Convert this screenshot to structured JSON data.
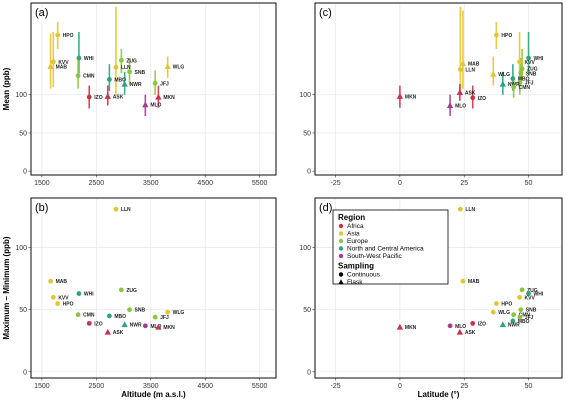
{
  "colors": {
    "Africa": "#c9324a",
    "Asia": "#e2c530",
    "Europe": "#8dc43f",
    "North and Central America": "#2ea37f",
    "South-West Pacific": "#a33c90"
  },
  "chart_data": [
    {
      "type": "scatter",
      "panel": "(a)",
      "ylabel": "Mean (ppb)",
      "xlabel": "",
      "x_ticks": [
        "1500",
        "2500",
        "3500",
        "4500",
        "5500"
      ],
      "y_ticks": [
        "0",
        "50",
        "100"
      ],
      "xlim": [
        1300,
        5800
      ],
      "ylim": [
        -5,
        220
      ],
      "grid": true,
      "points": [
        {
          "station": "HPO",
          "x": 1790,
          "y": 178,
          "lo": 160,
          "hi": 195,
          "region": "Asia",
          "sampling": "Continuous"
        },
        {
          "station": "KVV",
          "x": 1710,
          "y": 143,
          "lo": 110,
          "hi": 182,
          "region": "Asia",
          "sampling": "Continuous"
        },
        {
          "station": "MAB",
          "x": 1660,
          "y": 137,
          "lo": 108,
          "hi": 180,
          "region": "Asia",
          "sampling": "Flask"
        },
        {
          "station": "WHI",
          "x": 2180,
          "y": 148,
          "lo": 128,
          "hi": 182,
          "region": "North and Central America",
          "sampling": "Continuous"
        },
        {
          "station": "ZUG",
          "x": 2960,
          "y": 145,
          "lo": 128,
          "hi": 160,
          "region": "Europe",
          "sampling": "Continuous"
        },
        {
          "station": "LLN",
          "x": 2860,
          "y": 136,
          "lo": 100,
          "hi": 215,
          "region": "Asia",
          "sampling": "Continuous"
        },
        {
          "station": "CMN",
          "x": 2165,
          "y": 125,
          "lo": 108,
          "hi": 145,
          "region": "Europe",
          "sampling": "Continuous"
        },
        {
          "station": "MBO",
          "x": 2740,
          "y": 120,
          "lo": 105,
          "hi": 140,
          "region": "North and Central America",
          "sampling": "Continuous"
        },
        {
          "station": "SNB",
          "x": 3110,
          "y": 130,
          "lo": 112,
          "hi": 148,
          "region": "Europe",
          "sampling": "Continuous"
        },
        {
          "station": "NWR",
          "x": 3020,
          "y": 114,
          "lo": 100,
          "hi": 130,
          "region": "North and Central America",
          "sampling": "Flask"
        },
        {
          "station": "WLG",
          "x": 3810,
          "y": 137,
          "lo": 122,
          "hi": 150,
          "region": "Asia",
          "sampling": "Flask"
        },
        {
          "station": "JFJ",
          "x": 3580,
          "y": 115,
          "lo": 100,
          "hi": 132,
          "region": "Europe",
          "sampling": "Continuous"
        },
        {
          "station": "IZO",
          "x": 2370,
          "y": 97,
          "lo": 82,
          "hi": 112,
          "region": "Africa",
          "sampling": "Continuous"
        },
        {
          "station": "ASK",
          "x": 2710,
          "y": 98,
          "lo": 86,
          "hi": 112,
          "region": "Africa",
          "sampling": "Flask"
        },
        {
          "station": "MKN",
          "x": 3640,
          "y": 97,
          "lo": 83,
          "hi": 112,
          "region": "Africa",
          "sampling": "Flask"
        },
        {
          "station": "MLO",
          "x": 3400,
          "y": 87,
          "lo": 72,
          "hi": 100,
          "region": "South-West Pacific",
          "sampling": "Flask"
        }
      ]
    },
    {
      "type": "scatter",
      "panel": "(b)",
      "ylabel": "Maximum – Minimum (ppb)",
      "xlabel": "Altitude (m a.s.l.)",
      "x_ticks": [
        "1500",
        "2500",
        "3500",
        "4500",
        "5500"
      ],
      "y_ticks": [
        "0",
        "50",
        "100"
      ],
      "xlim": [
        1300,
        5800
      ],
      "ylim": [
        -5,
        140
      ],
      "grid": true,
      "points": [
        {
          "station": "LLN",
          "x": 2860,
          "y": 131,
          "region": "Asia",
          "sampling": "Continuous"
        },
        {
          "station": "MAB",
          "x": 1660,
          "y": 73,
          "region": "Asia",
          "sampling": "Continuous"
        },
        {
          "station": "ZUG",
          "x": 2960,
          "y": 66,
          "region": "Europe",
          "sampling": "Continuous"
        },
        {
          "station": "WHI",
          "x": 2180,
          "y": 63,
          "region": "North and Central America",
          "sampling": "Continuous"
        },
        {
          "station": "KVV",
          "x": 1710,
          "y": 60,
          "region": "Asia",
          "sampling": "Continuous"
        },
        {
          "station": "HPO",
          "x": 1790,
          "y": 55,
          "region": "Asia",
          "sampling": "Continuous"
        },
        {
          "station": "SNB",
          "x": 3110,
          "y": 50,
          "region": "Europe",
          "sampling": "Continuous"
        },
        {
          "station": "WLG",
          "x": 3810,
          "y": 48,
          "region": "Asia",
          "sampling": "Continuous"
        },
        {
          "station": "CMN",
          "x": 2165,
          "y": 46,
          "region": "Europe",
          "sampling": "Continuous"
        },
        {
          "station": "MBO",
          "x": 2740,
          "y": 45,
          "region": "North and Central America",
          "sampling": "Continuous"
        },
        {
          "station": "JFJ",
          "x": 3580,
          "y": 44,
          "region": "Europe",
          "sampling": "Continuous"
        },
        {
          "station": "NWR",
          "x": 3020,
          "y": 38,
          "region": "North and Central America",
          "sampling": "Flask"
        },
        {
          "station": "IZO",
          "x": 2370,
          "y": 39,
          "region": "Africa",
          "sampling": "Continuous"
        },
        {
          "station": "MLO",
          "x": 3400,
          "y": 37,
          "region": "South-West Pacific",
          "sampling": "Continuous"
        },
        {
          "station": "MKN",
          "x": 3640,
          "y": 36,
          "region": "Africa",
          "sampling": "Flask"
        },
        {
          "station": "ASK",
          "x": 2710,
          "y": 32,
          "region": "Africa",
          "sampling": "Flask"
        }
      ]
    },
    {
      "type": "scatter",
      "panel": "(c)",
      "ylabel": "",
      "xlabel": "",
      "x_ticks": [
        "-25",
        "0",
        "25",
        "50"
      ],
      "y_ticks": [
        "0",
        "50",
        "100"
      ],
      "xlim": [
        -33,
        63
      ],
      "ylim": [
        -5,
        220
      ],
      "grid": true,
      "points": [
        {
          "station": "HPO",
          "x": 37.5,
          "y": 178,
          "lo": 160,
          "hi": 195,
          "region": "Asia",
          "sampling": "Continuous"
        },
        {
          "station": "MAB",
          "x": 24.5,
          "y": 141,
          "lo": 108,
          "hi": 210,
          "region": "Asia",
          "sampling": "Flask"
        },
        {
          "station": "LLN",
          "x": 23.5,
          "y": 133,
          "lo": 100,
          "hi": 215,
          "region": "Asia",
          "sampling": "Continuous"
        },
        {
          "station": "WHI",
          "x": 50,
          "y": 148,
          "lo": 128,
          "hi": 182,
          "region": "North and Central America",
          "sampling": "Continuous"
        },
        {
          "station": "KVV",
          "x": 46.5,
          "y": 143,
          "lo": 110,
          "hi": 182,
          "region": "Asia",
          "sampling": "Continuous"
        },
        {
          "station": "ZUG",
          "x": 47.5,
          "y": 134,
          "lo": 120,
          "hi": 160,
          "region": "Europe",
          "sampling": "Continuous"
        },
        {
          "station": "SNB",
          "x": 47,
          "y": 128,
          "lo": 112,
          "hi": 148,
          "region": "Europe",
          "sampling": "Continuous"
        },
        {
          "station": "WLG",
          "x": 36.3,
          "y": 127,
          "lo": 112,
          "hi": 150,
          "region": "Asia",
          "sampling": "Flask"
        },
        {
          "station": "MBO",
          "x": 43.9,
          "y": 121,
          "lo": 105,
          "hi": 140,
          "region": "North and Central America",
          "sampling": "Continuous"
        },
        {
          "station": "JFJ",
          "x": 46.6,
          "y": 116,
          "lo": 100,
          "hi": 132,
          "region": "Europe",
          "sampling": "Continuous"
        },
        {
          "station": "NWR",
          "x": 40,
          "y": 114,
          "lo": 100,
          "hi": 130,
          "region": "North and Central America",
          "sampling": "Flask"
        },
        {
          "station": "CMN",
          "x": 44.2,
          "y": 110,
          "lo": 96,
          "hi": 125,
          "region": "Europe",
          "sampling": "Continuous"
        },
        {
          "station": "MKN",
          "x": 0,
          "y": 98,
          "lo": 83,
          "hi": 112,
          "region": "Africa",
          "sampling": "Flask"
        },
        {
          "station": "ASK",
          "x": 23.3,
          "y": 103,
          "lo": 92,
          "hi": 114,
          "region": "Africa",
          "sampling": "Flask"
        },
        {
          "station": "IZO",
          "x": 28.3,
          "y": 96,
          "lo": 82,
          "hi": 112,
          "region": "Africa",
          "sampling": "Continuous"
        },
        {
          "station": "MLO",
          "x": 19.5,
          "y": 86,
          "lo": 72,
          "hi": 100,
          "region": "South-West Pacific",
          "sampling": "Flask"
        }
      ]
    },
    {
      "type": "scatter",
      "panel": "(d)",
      "ylabel": "",
      "xlabel": "Latitude (°)",
      "x_ticks": [
        "-25",
        "0",
        "25",
        "50"
      ],
      "y_ticks": [
        "0",
        "50",
        "100"
      ],
      "xlim": [
        -33,
        63
      ],
      "ylim": [
        -5,
        140
      ],
      "grid": true,
      "legend_position": "top-left",
      "points": [
        {
          "station": "LLN",
          "x": 23.5,
          "y": 131,
          "region": "Asia",
          "sampling": "Continuous"
        },
        {
          "station": "MAB",
          "x": 24.5,
          "y": 73,
          "region": "Asia",
          "sampling": "Continuous"
        },
        {
          "station": "ZUG",
          "x": 47.5,
          "y": 66,
          "region": "Europe",
          "sampling": "Continuous"
        },
        {
          "station": "WHI",
          "x": 50,
          "y": 63,
          "region": "North and Central America",
          "sampling": "Continuous"
        },
        {
          "station": "KVV",
          "x": 46.5,
          "y": 60,
          "region": "Asia",
          "sampling": "Continuous"
        },
        {
          "station": "HPO",
          "x": 37.5,
          "y": 55,
          "region": "Asia",
          "sampling": "Continuous"
        },
        {
          "station": "SNB",
          "x": 47,
          "y": 50,
          "region": "Europe",
          "sampling": "Continuous"
        },
        {
          "station": "WLG",
          "x": 36.3,
          "y": 48,
          "region": "Asia",
          "sampling": "Continuous"
        },
        {
          "station": "CMN",
          "x": 44.2,
          "y": 46,
          "region": "Europe",
          "sampling": "Continuous"
        },
        {
          "station": "JFJ",
          "x": 46.6,
          "y": 44,
          "region": "Europe",
          "sampling": "Continuous"
        },
        {
          "station": "MBO",
          "x": 43.9,
          "y": 41,
          "region": "North and Central America",
          "sampling": "Continuous"
        },
        {
          "station": "IZO",
          "x": 28.3,
          "y": 39,
          "region": "Africa",
          "sampling": "Continuous"
        },
        {
          "station": "NWR",
          "x": 40,
          "y": 38,
          "region": "North and Central America",
          "sampling": "Flask"
        },
        {
          "station": "MLO",
          "x": 19.5,
          "y": 37,
          "region": "South-West Pacific",
          "sampling": "Continuous"
        },
        {
          "station": "MKN",
          "x": 0,
          "y": 36,
          "region": "Africa",
          "sampling": "Flask"
        },
        {
          "station": "ASK",
          "x": 23.3,
          "y": 32,
          "region": "Africa",
          "sampling": "Flask"
        }
      ]
    }
  ],
  "legend": {
    "region_title": "Region",
    "regions": [
      "Africa",
      "Asia",
      "Europe",
      "North and Central America",
      "South-West Pacific"
    ],
    "sampling_title": "Sampling",
    "sampling": [
      "Continuous",
      "Flask"
    ]
  }
}
